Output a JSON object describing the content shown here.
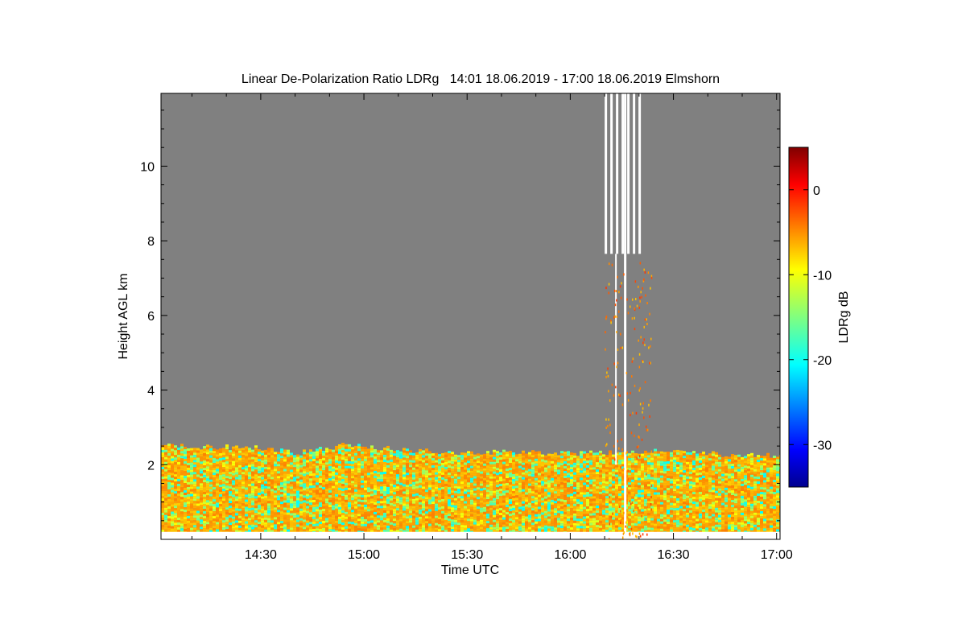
{
  "chart_data": {
    "type": "heatmap",
    "title": "Linear De-Polarization Ratio LDRg   14:01 18.06.2019 - 17:00 18.06.2019 Elmshorn",
    "xlabel": "Time UTC",
    "ylabel": "Height AGL km",
    "x_range": [
      "14:01",
      "17:00"
    ],
    "xlim_minutes": [
      841,
      1021
    ],
    "x_ticks": [
      "14:30",
      "15:00",
      "15:30",
      "16:00",
      "16:30",
      "17:00"
    ],
    "x_tick_minutes": [
      870,
      900,
      930,
      960,
      990,
      1020
    ],
    "ylim": [
      0,
      11.95
    ],
    "y_ticks": [
      2,
      4,
      6,
      8,
      10
    ],
    "colorbar": {
      "label": "LDRg dB",
      "range": [
        -35,
        5
      ],
      "ticks": [
        0,
        -10,
        -20,
        -30
      ],
      "colormap": "jet"
    },
    "background_color": "#808080",
    "boundary_layer_top_km": [
      {
        "t": "14:01",
        "h": 2.5
      },
      {
        "t": "14:30",
        "h": 2.45
      },
      {
        "t": "14:40",
        "h": 2.3
      },
      {
        "t": "14:55",
        "h": 2.55
      },
      {
        "t": "15:10",
        "h": 2.4
      },
      {
        "t": "15:30",
        "h": 2.3
      },
      {
        "t": "15:45",
        "h": 2.35
      },
      {
        "t": "16:00",
        "h": 2.3
      },
      {
        "t": "16:30",
        "h": 2.4
      },
      {
        "t": "16:45",
        "h": 2.25
      },
      {
        "t": "17:00",
        "h": 2.25
      }
    ],
    "boundary_layer_ldr_db": [
      -20,
      -5
    ],
    "precipitation_period": {
      "start": "16:10",
      "end": "16:20",
      "max_height_km": 11.95
    }
  }
}
